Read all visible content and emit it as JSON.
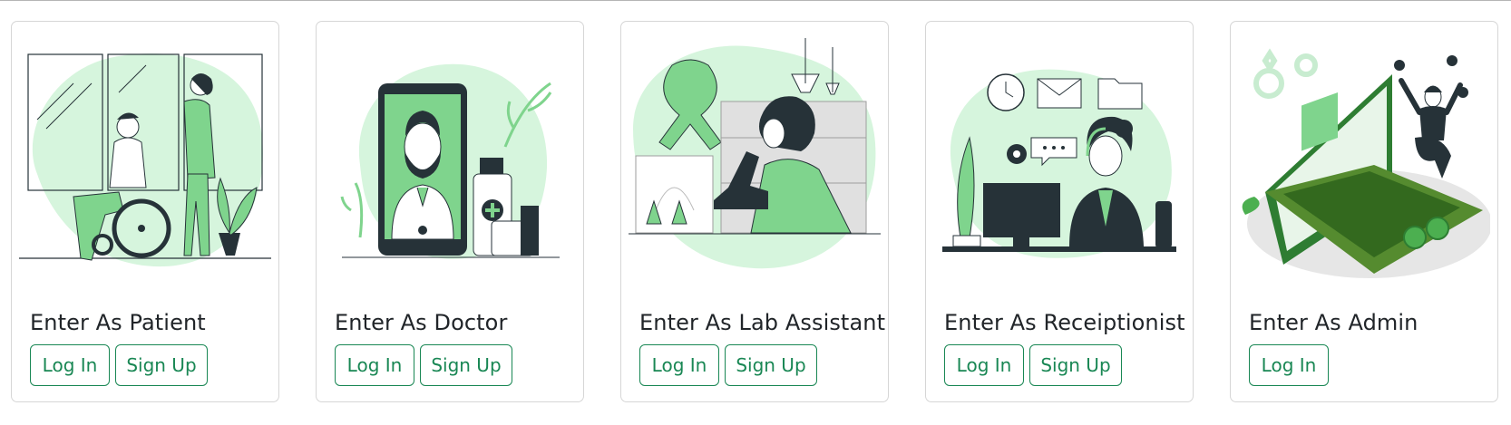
{
  "colors": {
    "accent": "#198754",
    "blob": "#d6f5dd",
    "green": "#7fd48d",
    "dark": "#263238"
  },
  "cards": [
    {
      "title": "Enter As Patient",
      "login_label": "Log In",
      "signup_label": "Sign Up",
      "illustration": "patient-wheelchair-illustration"
    },
    {
      "title": "Enter As Doctor",
      "login_label": "Log In",
      "signup_label": "Sign Up",
      "illustration": "doctor-phone-illustration"
    },
    {
      "title": "Enter As Lab Assistant",
      "login_label": "Log In",
      "signup_label": "Sign Up",
      "illustration": "lab-microscope-illustration"
    },
    {
      "title": "Enter As Receiptionist",
      "login_label": "Log In",
      "signup_label": "Sign Up",
      "illustration": "receptionist-desk-illustration"
    },
    {
      "title": "Enter As Admin",
      "login_label": "Log In",
      "illustration": "admin-laptop-illustration"
    }
  ]
}
